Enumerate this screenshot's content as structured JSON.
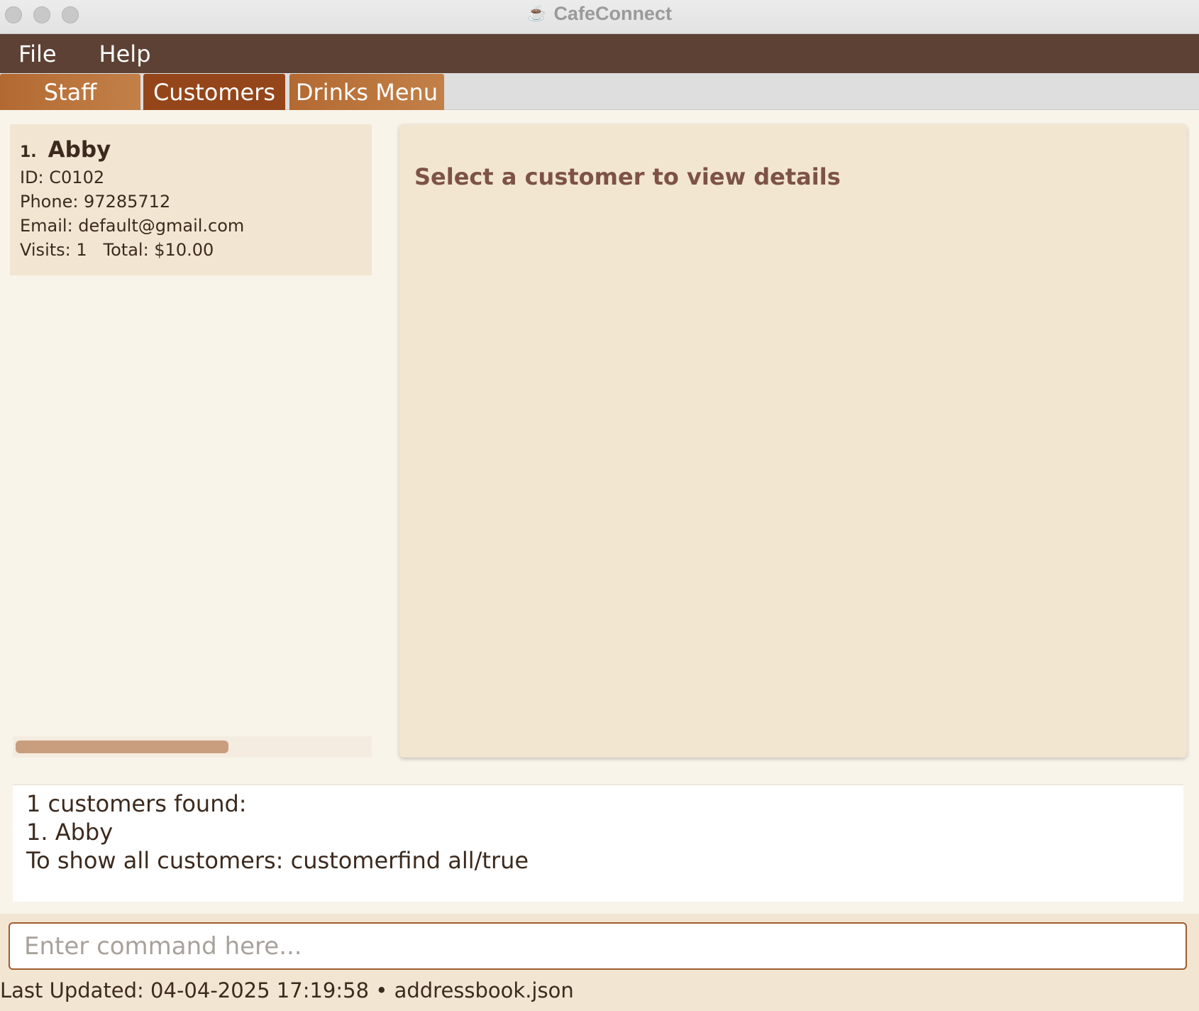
{
  "window": {
    "title": "CafeConnect",
    "icon": "coffee-cup-icon"
  },
  "menubar": {
    "items": [
      {
        "label": "File"
      },
      {
        "label": "Help"
      }
    ]
  },
  "tabs": [
    {
      "label": "Staff",
      "selected": false
    },
    {
      "label": "Customers",
      "selected": true
    },
    {
      "label": "Drinks Menu",
      "selected": false
    }
  ],
  "customer_list": {
    "items": [
      {
        "index": "1.",
        "name": "Abby",
        "id_line": "ID: C0102",
        "phone_line": "Phone: 97285712",
        "email_line": "Email: default@gmail.com",
        "stats_line": "Visits: 1   Total: $10.00"
      }
    ]
  },
  "detail": {
    "placeholder": "Select a customer to view details"
  },
  "result": {
    "lines": [
      "1 customers found:",
      "1. Abby",
      "To show all customers: customerfind all/true"
    ]
  },
  "command": {
    "value": "",
    "placeholder": "Enter command here..."
  },
  "status": {
    "text": "Last Updated: 04-04-2025 17:19:58 • addressbook.json"
  },
  "colors": {
    "menubar": "#5d4134",
    "tab_normal": "#b36a32",
    "tab_selected": "#94461a",
    "card": "#f2e6d2",
    "detail_text": "#7d5345",
    "input_border": "#a05c2e"
  }
}
